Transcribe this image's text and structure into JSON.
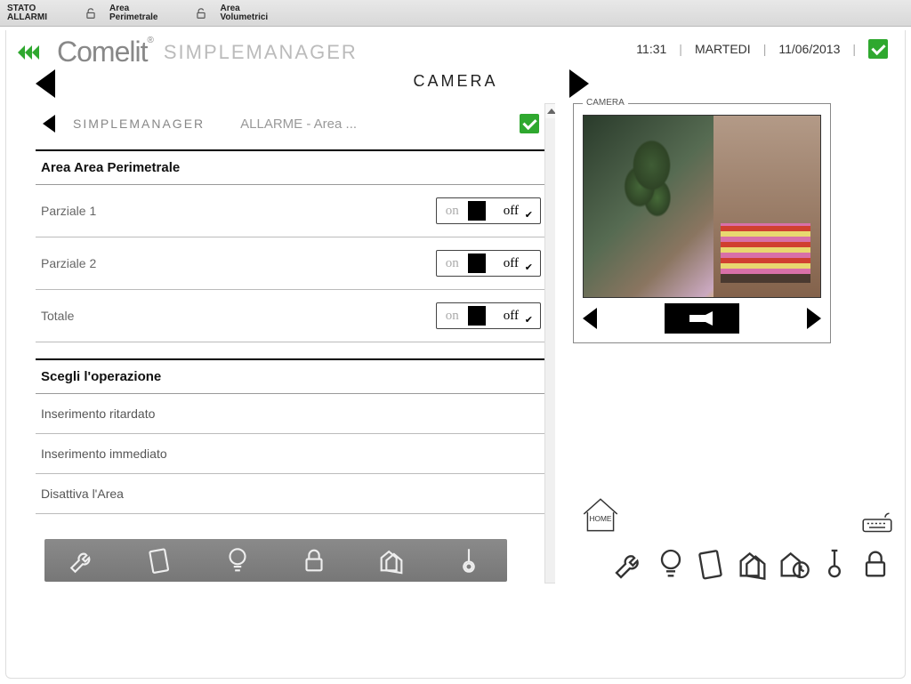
{
  "topbar": {
    "status_line1": "STATO",
    "status_line2": "ALLARMI",
    "area1_line1": "Area",
    "area1_line2": "Perimetrale",
    "area2_line1": "Area",
    "area2_line2": "Volumetrici"
  },
  "brand": {
    "name": "Comelit",
    "app": "SIMPLEMANAGER"
  },
  "clock": {
    "time": "11:31",
    "day": "MARTEDI",
    "date": "11/06/2013"
  },
  "page": {
    "title": "CAMERA"
  },
  "breadcrumb": {
    "root": "SIMPLEMANAGER",
    "sub": "ALLARME - Area ..."
  },
  "area_section": {
    "title": "Area Area Perimetrale",
    "rows": [
      {
        "label": "Parziale 1",
        "on": "on",
        "off": "off"
      },
      {
        "label": "Parziale 2",
        "on": "on",
        "off": "off"
      },
      {
        "label": "Totale",
        "on": "on",
        "off": "off"
      }
    ]
  },
  "ops_section": {
    "title": "Scegli l'operazione",
    "rows": [
      {
        "label": "Inserimento ritardato"
      },
      {
        "label": "Inserimento immediato"
      },
      {
        "label": "Disattiva l'Area"
      }
    ]
  },
  "camera": {
    "label": "CAMERA",
    "home_label": "HOME"
  }
}
